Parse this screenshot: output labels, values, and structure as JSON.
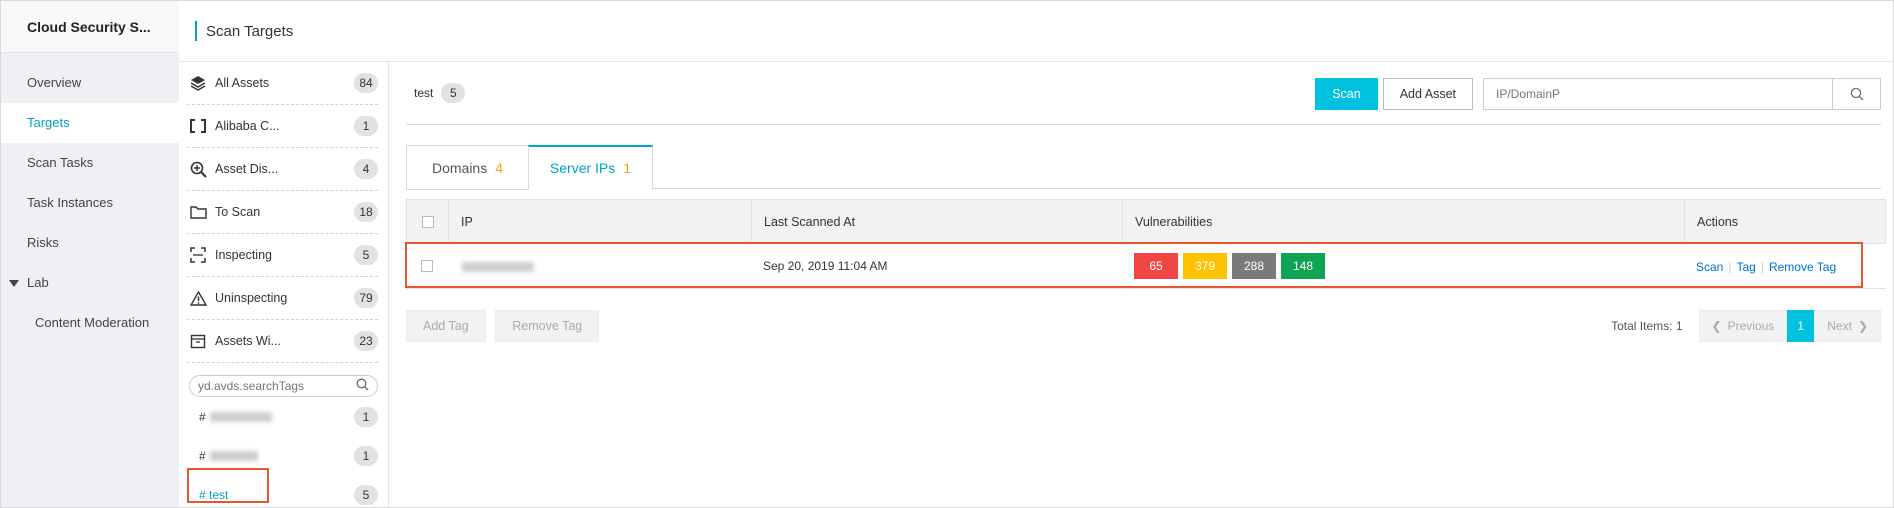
{
  "app": {
    "brand": "Cloud Security S..."
  },
  "nav": {
    "items": [
      {
        "label": "Overview"
      },
      {
        "label": "Targets"
      },
      {
        "label": "Scan Tasks"
      },
      {
        "label": "Task Instances"
      },
      {
        "label": "Risks"
      },
      {
        "label": "Lab"
      },
      {
        "label": "Content Moderation"
      }
    ],
    "active": "Targets"
  },
  "header": {
    "title": "Scan Targets"
  },
  "sidebar": {
    "categories": [
      {
        "label": "All Assets",
        "count": "84",
        "icon": "layers-icon"
      },
      {
        "label": "Alibaba C...",
        "count": "1",
        "icon": "bracket-frame-icon"
      },
      {
        "label": "Asset Dis...",
        "count": "4",
        "icon": "zoom-in-icon"
      },
      {
        "label": "To Scan",
        "count": "18",
        "icon": "folder-icon"
      },
      {
        "label": "Inspecting",
        "count": "5",
        "icon": "scan-frame-icon"
      },
      {
        "label": "Uninspecting",
        "count": "79",
        "icon": "warning-icon"
      },
      {
        "label": "Assets Wi...",
        "count": "23",
        "icon": "archive-icon"
      }
    ],
    "tag_search_placeholder": "yd.avds.searchTags",
    "tags": [
      {
        "prefix": "#",
        "label": "",
        "count": "1",
        "blurred": true
      },
      {
        "prefix": "#",
        "label": "",
        "count": "1",
        "blurred": true
      },
      {
        "prefix": "#",
        "label": "test",
        "count": "5",
        "blurred": false
      }
    ]
  },
  "main": {
    "selected_tag": "test",
    "selected_count": "5",
    "scan_button": "Scan",
    "add_asset_button": "Add Asset",
    "search_placeholder": "IP/DomainP",
    "tabs": [
      {
        "label": "Domains",
        "count": "4"
      },
      {
        "label": "Server IPs",
        "count": "1"
      }
    ],
    "active_tab": "Server IPs",
    "table": {
      "columns": [
        "IP",
        "Last Scanned At",
        "Vulnerabilities",
        "Actions"
      ],
      "rows": [
        {
          "ip": "",
          "last_scanned": "Sep 20, 2019 11:04 AM",
          "vulns": [
            {
              "value": "65",
              "color": "#f04545"
            },
            {
              "value": "379",
              "color": "#ffc200"
            },
            {
              "value": "288",
              "color": "#7a7a7a"
            },
            {
              "value": "148",
              "color": "#11a354"
            }
          ],
          "actions": [
            "Scan",
            "Tag",
            "Remove Tag"
          ]
        }
      ]
    },
    "add_tag_button": "Add Tag",
    "remove_tag_button": "Remove Tag",
    "total_items": "Total Items: 1",
    "pager": {
      "previous": "Previous",
      "current": "1",
      "next": "Next"
    }
  },
  "colors": {
    "accent": "#00a2ca",
    "primary_button": "#00c1de",
    "highlight": "#e8552e"
  }
}
